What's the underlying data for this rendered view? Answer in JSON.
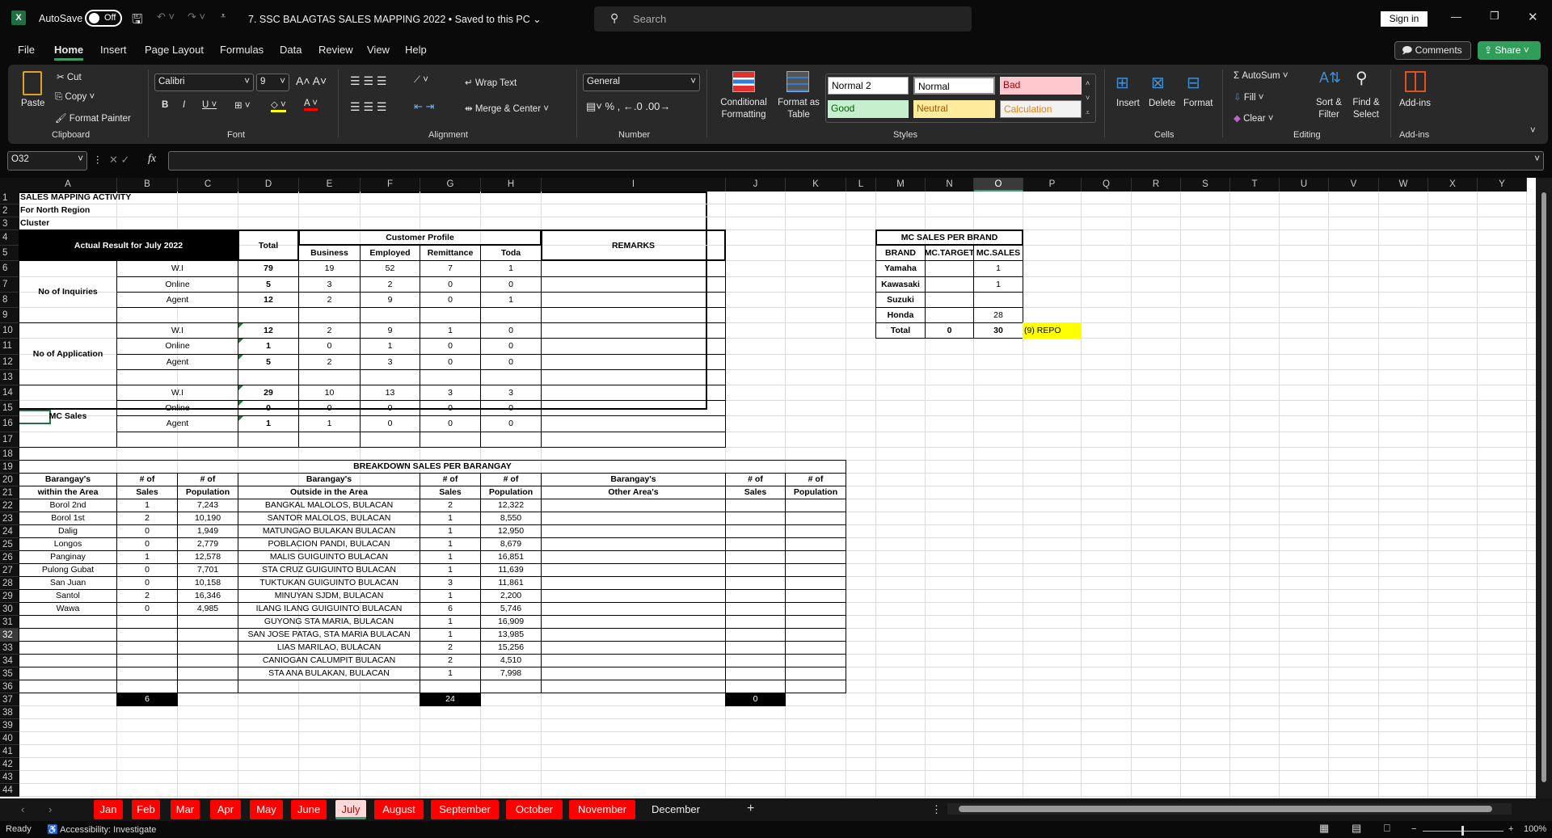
{
  "titlebar": {
    "autosave_label": "AutoSave",
    "autosave_state": "Off",
    "doc_title": "7. SSC BALAGTAS SALES MAPPING 2022 • Saved to this PC ⌄",
    "search_placeholder": "Search",
    "sign_in": "Sign in"
  },
  "menu": {
    "tabs": [
      "File",
      "Home",
      "Insert",
      "Page Layout",
      "Formulas",
      "Data",
      "Review",
      "View",
      "Help"
    ],
    "active": "Home",
    "comments": "Comments",
    "share": "Share"
  },
  "ribbon": {
    "clipboard": {
      "label": "Clipboard",
      "paste": "Paste",
      "cut": "Cut",
      "copy": "Copy",
      "format_painter": "Format Painter"
    },
    "font": {
      "label": "Font",
      "name": "Calibri",
      "size": "9"
    },
    "alignment": {
      "label": "Alignment",
      "wrap_text": "Wrap Text",
      "merge_center": "Merge & Center"
    },
    "number": {
      "label": "Number",
      "format": "General"
    },
    "styles": {
      "label": "Styles",
      "conditional_formatting": "Conditional Formatting",
      "format_as_table": "Format as Table",
      "gallery": [
        "Normal 2",
        "Normal",
        "Bad",
        "Good",
        "Neutral",
        "Calculation"
      ]
    },
    "cells": {
      "label": "Cells",
      "insert": "Insert",
      "delete": "Delete",
      "format": "Format"
    },
    "editing": {
      "label": "Editing",
      "autosum": "AutoSum",
      "fill": "Fill",
      "clear": "Clear",
      "sort_filter": "Sort & Filter",
      "find_select": "Find & Select"
    },
    "addins": {
      "label": "Add-ins",
      "addins": "Add-ins"
    }
  },
  "formula_bar": {
    "name_box": "O32",
    "formula": ""
  },
  "columns": [
    "A",
    "B",
    "C",
    "D",
    "E",
    "F",
    "G",
    "H",
    "I",
    "J",
    "K",
    "L",
    "M",
    "N",
    "O",
    "P",
    "Q",
    "R",
    "S",
    "T",
    "U",
    "V",
    "W",
    "X",
    "Y"
  ],
  "selected_cell": {
    "column": "O",
    "row": 32
  },
  "sheet": {
    "title": "SALES MAPPING ACTIVITY",
    "subtitle": "For North Region",
    "cluster": "Cluster",
    "summary": {
      "header": "Actual Result for July 2022",
      "total": "Total",
      "customer_profile": "Customer Profile",
      "profile_cols": [
        "Business",
        "Employed",
        "Remittance",
        "Toda"
      ],
      "remarks": "REMARKS",
      "groups": [
        {
          "label": "No of Inquiries",
          "rows": [
            {
              "channel": "W.I",
              "total": "79",
              "values": [
                "19",
                "52",
                "7",
                "1"
              ]
            },
            {
              "channel": "Online",
              "total": "5",
              "values": [
                "3",
                "2",
                "0",
                "0"
              ]
            },
            {
              "channel": "Agent",
              "total": "12",
              "values": [
                "2",
                "9",
                "0",
                "1"
              ]
            }
          ]
        },
        {
          "label": "No of Application",
          "rows": [
            {
              "channel": "W.I",
              "total": "12",
              "values": [
                "2",
                "9",
                "1",
                "0"
              ]
            },
            {
              "channel": "Online",
              "total": "1",
              "values": [
                "0",
                "1",
                "0",
                "0"
              ]
            },
            {
              "channel": "Agent",
              "total": "5",
              "values": [
                "2",
                "3",
                "0",
                "0"
              ]
            }
          ]
        },
        {
          "label": "MC Sales",
          "rows": [
            {
              "channel": "W.I",
              "total": "29",
              "values": [
                "10",
                "13",
                "3",
                "3"
              ]
            },
            {
              "channel": "Online",
              "total": "0",
              "values": [
                "0",
                "0",
                "0",
                "0"
              ]
            },
            {
              "channel": "Agent",
              "total": "1",
              "values": [
                "1",
                "0",
                "0",
                "0"
              ]
            }
          ]
        }
      ]
    },
    "breakdown": {
      "title": "BREAKDOWN SALES PER BARANGAY",
      "headers": [
        [
          "Barangay's",
          "within the Area"
        ],
        [
          "# of",
          "Sales"
        ],
        [
          "# of",
          "Population"
        ],
        [
          "Barangay's",
          "Outside in the Area"
        ],
        [
          "# of",
          "Sales"
        ],
        [
          "# of",
          "Population"
        ],
        [
          "Barangay's",
          "Other Area's"
        ],
        [
          "# of",
          "Sales"
        ],
        [
          "# of",
          "Population"
        ]
      ],
      "within": [
        [
          "Borol 2nd",
          "1",
          "7,243"
        ],
        [
          "Borol 1st",
          "2",
          "10,190"
        ],
        [
          "Dalig",
          "0",
          "1,949"
        ],
        [
          "Longos",
          "0",
          "2,779"
        ],
        [
          "Panginay",
          "1",
          "12,578"
        ],
        [
          "Pulong Gubat",
          "0",
          "7,701"
        ],
        [
          "San Juan",
          "0",
          "10,158"
        ],
        [
          "Santol",
          "2",
          "16,346"
        ],
        [
          "Wawa",
          "0",
          "4,985"
        ]
      ],
      "outside": [
        [
          "BANGKAL MALOLOS, BULACAN",
          "2",
          "12,322"
        ],
        [
          "SANTOR MALOLOS, BULACAN",
          "1",
          "8,550"
        ],
        [
          "MATUNGAO BULAKAN BULACAN",
          "1",
          "12,950"
        ],
        [
          "POBLACION PANDI, BULACAN",
          "1",
          "8,679"
        ],
        [
          "MALIS GUIGUINTO BULACAN",
          "1",
          "16,851"
        ],
        [
          "STA CRUZ GUIGUINTO BULACAN",
          "1",
          "11,639"
        ],
        [
          "TUKTUKAN GUIGUINTO BULACAN",
          "3",
          "11,861"
        ],
        [
          "MINUYAN SJDM, BULACAN",
          "1",
          "2,200"
        ],
        [
          "ILANG ILANG GUIGUINTO BULACAN",
          "6",
          "5,746"
        ],
        [
          "GUYONG STA MARIA, BULACAN",
          "1",
          "16,909"
        ],
        [
          "SAN JOSE PATAG, STA MARIA BULACAN",
          "1",
          "13,985"
        ],
        [
          "LIAS MARILAO, BULACAN",
          "2",
          "15,256"
        ],
        [
          "CANIOGAN CALUMPIT BULACAN",
          "2",
          "4,510"
        ],
        [
          "STA ANA BULAKAN, BULACAN",
          "1",
          "7,998"
        ]
      ],
      "totals": {
        "within_sales": "6",
        "outside_sales": "24",
        "other_sales": "0"
      }
    },
    "brand": {
      "title": "MC SALES PER BRAND",
      "headers": [
        "BRAND",
        "MC.TARGET",
        "MC.SALES"
      ],
      "rows": [
        [
          "Yamaha",
          "",
          "1"
        ],
        [
          "Kawasaki",
          "",
          "1"
        ],
        [
          "Suzuki",
          "",
          ""
        ],
        [
          "Honda",
          "",
          "28"
        ],
        [
          "Total",
          "0",
          "30"
        ]
      ],
      "note": "(9) REPO",
      "note_color": "#ffff00"
    }
  },
  "sheet_tabs": [
    "Jan",
    "Feb",
    "Mar",
    "Apr",
    "May",
    "June",
    "July",
    "August",
    "September",
    "October",
    "November",
    "December"
  ],
  "active_sheet": "July",
  "status": {
    "ready": "Ready",
    "accessibility": "Accessibility: Investigate",
    "zoom": "100%"
  }
}
